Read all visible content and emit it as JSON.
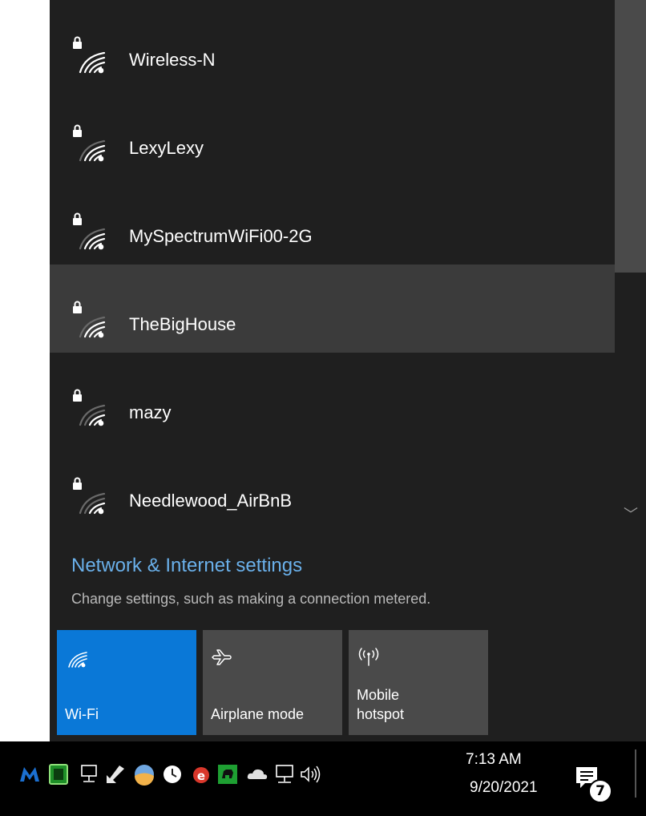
{
  "networks": [
    {
      "name": "Wireless-N",
      "selected": false,
      "icon": "wifi-secured-icon"
    },
    {
      "name": "LexyLexy",
      "selected": false,
      "icon": "wifi-secured-icon"
    },
    {
      "name": "MySpectrumWiFi00-2G",
      "selected": false,
      "icon": "wifi-secured-icon"
    },
    {
      "name": "TheBigHouse",
      "selected": true,
      "icon": "wifi-secured-icon"
    },
    {
      "name": "mazy",
      "selected": false,
      "icon": "wifi-secured-icon"
    },
    {
      "name": "Needlewood_AirBnB",
      "selected": false,
      "icon": "wifi-secured-icon"
    }
  ],
  "settings": {
    "link": "Network & Internet settings",
    "description": "Change settings, such as making a connection metered."
  },
  "quick_actions": [
    {
      "label": "Wi-Fi",
      "active": true,
      "icon": "wifi-icon"
    },
    {
      "label": "Airplane mode",
      "active": false,
      "icon": "airplane-icon"
    },
    {
      "label": "Mobile\nhotspot",
      "active": false,
      "icon": "hotspot-icon"
    }
  ],
  "taskbar": {
    "time": "7:13 AM",
    "date": "9/20/2021",
    "notification_count": "7",
    "tray_icons": [
      "malwarebytes-icon",
      "app-green-icon",
      "network-wired-icon",
      "pointer-app-icon",
      "weather-icon",
      "clock-app-icon",
      "ie-icon",
      "dog-app-icon",
      "onedrive-icon",
      "network-icon",
      "volume-icon"
    ]
  },
  "colors": {
    "panel_bg": "#1f1f1f",
    "selected_bg": "#3b3b3b",
    "accent": "#0a78d7",
    "link": "#6ab0ea",
    "tile_bg": "#4a4a4a"
  }
}
